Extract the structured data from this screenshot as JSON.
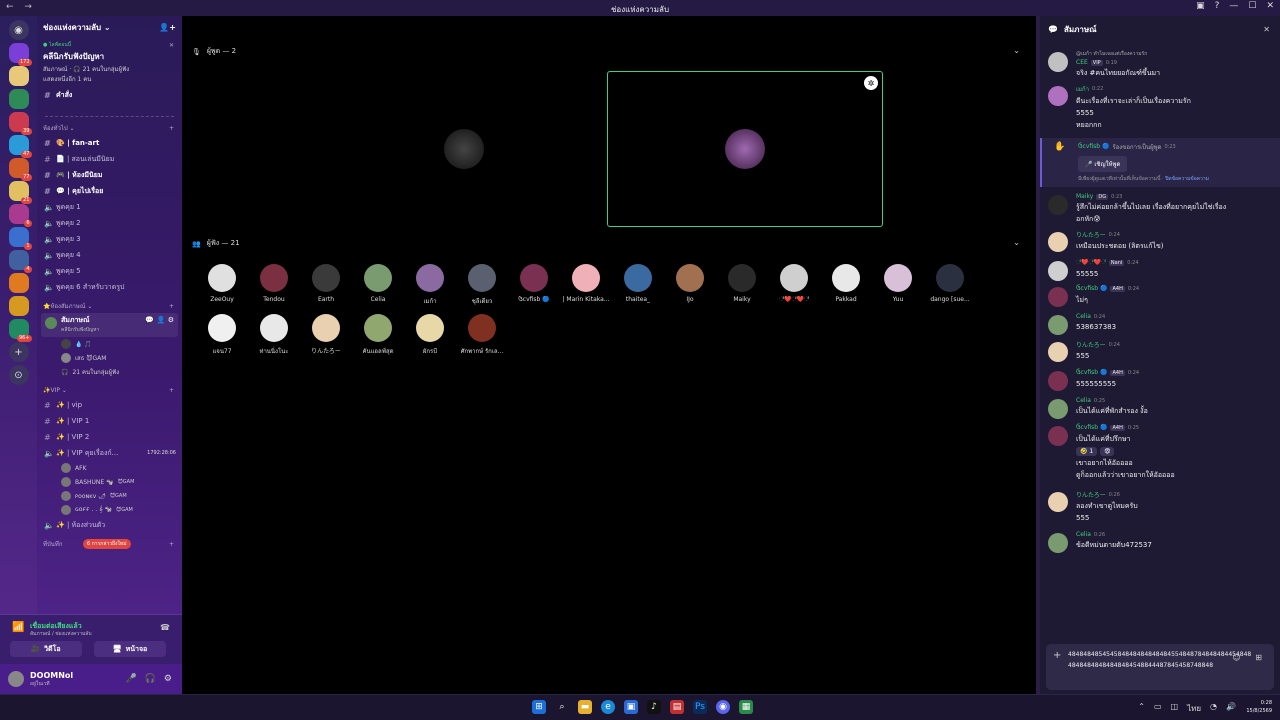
{
  "window": {
    "title": "ช่องแห่งความลับ",
    "nav": "← →"
  },
  "server": {
    "name": "ช่องแห่งความลับ ⌄"
  },
  "servers": [
    {
      "color": "#7a3fd6",
      "count": "172"
    },
    {
      "color": "#e8c97a",
      "count": ""
    },
    {
      "color": "#2e8b57",
      "count": ""
    },
    {
      "color": "#cc3a50",
      "count": "39"
    },
    {
      "color": "#2a9bd8",
      "count": "47"
    },
    {
      "color": "#d05a2a",
      "count": "77"
    },
    {
      "color": "#e0c060",
      "count": "21"
    },
    {
      "color": "#aa3a90",
      "count": "6"
    },
    {
      "color": "#3a6fd0",
      "count": "1"
    },
    {
      "color": "#4060a0",
      "count": "4"
    },
    {
      "color": "#e07a20",
      "count": ""
    },
    {
      "color": "#d69a20",
      "count": ""
    },
    {
      "color": "#208a60",
      "count": "96+"
    }
  ],
  "event": {
    "live": "● ไลฟ์ตอนนี้",
    "title": "คลีนิกรับฟังปัญหา",
    "sub": "สัมภาษณ์ · 🎧 21 คนในกลุ่มผู้ฟัง",
    "more": "แสดงหนึ่งอีก 1 คน"
  },
  "channels_top": [
    {
      "label": "คำสั่ง",
      "bold": true
    }
  ],
  "cat_rooms": "ห้องทั่วไป ⌄",
  "rooms": [
    {
      "label": "🎨 | fan-art",
      "bold": true
    },
    {
      "label": "📄 | สอนเล่นมีนิยม",
      "bold": false
    },
    {
      "label": "🎮 | ห้องมีนิยม",
      "bold": true
    },
    {
      "label": "💬 | คุยไปเรื่อย",
      "bold": true
    },
    {
      "label": "พูดคุย 1",
      "bold": false
    },
    {
      "label": "พูดคุย 2",
      "bold": false
    },
    {
      "label": "พูดคุย 3",
      "bold": false
    },
    {
      "label": "พูดคุย 4",
      "bold": false
    },
    {
      "label": "พูดคุย 5",
      "bold": false
    },
    {
      "label": "พูดคุย 6 สำหรับวาดรูป",
      "bold": false
    }
  ],
  "cat_stage": "⭐ห้องสัมภาษณ์ ⌄",
  "stage": {
    "name": "สัมภาษณ์",
    "topic": "คลีนิกรับฟังปัญหา",
    "members": [
      "💧 🎵",
      "เสธ 😈GAM",
      "21 คนในกลุ่มผู้ฟัง"
    ]
  },
  "cat_vip": "✨VIP ⌄",
  "vip_channels": [
    {
      "label": "✨ | vip",
      "time": ""
    },
    {
      "label": "✨ | VIP 1",
      "time": ""
    },
    {
      "label": "✨ | VIP 2",
      "time": ""
    },
    {
      "label": "✨ | VIP คุยเรื่องก์...",
      "time": "1792:28:06"
    }
  ],
  "vip_members": [
    {
      "name": "AFK",
      "tag": ""
    },
    {
      "name": "BASHUNE 🐄",
      "tag": "😈GAM"
    },
    {
      "name": "ᴘᴏᴏɴᴋᴠ 🌶",
      "tag": "😈GAM"
    },
    {
      "name": "ɢᴏғғ . . 𝄞 🐄",
      "tag": "😈GAM"
    }
  ],
  "last_channel": "✨ | ห้องส่วนตัว",
  "cat_bottom": "ที่บันทึก",
  "new_badge": "6 การกล่าวถึงใหม่",
  "voice": {
    "connected": "เชื่อมต่อเสียงแล้ว",
    "sub": "สัมภาษณ์ / ช่องแห่งความลับ",
    "video": "วิดีโอ",
    "screen": "หน้าจอ"
  },
  "user": {
    "name": "DOOMNol",
    "status": "อยู่ในเวที"
  },
  "main": {
    "speakers_label": "ผู้พูด — 2",
    "audience_label": "ผู้ฟัง — 21",
    "speakers": [
      {
        "bg": "#d4c9a8"
      },
      {
        "bg": "#4a2e32"
      }
    ],
    "audience": [
      {
        "name": "ZeeOuy",
        "c": "#e0e0e0"
      },
      {
        "name": "Tendou",
        "c": "#7a3040"
      },
      {
        "name": "Earth",
        "c": "#3a3a3a"
      },
      {
        "name": "Celia",
        "c": "#7a9a70"
      },
      {
        "name": "เมก้า",
        "c": "#8a6aa0"
      },
      {
        "name": "ชุลีเดียว",
        "c": "#5a6070"
      },
      {
        "name": "ઉcvfisb 🔵",
        "c": "#7a3050"
      },
      {
        "name": "| Marin Kitaka...",
        "c": "#f0b0b8"
      },
      {
        "name": "thaitea_",
        "c": "#3a6aa0"
      },
      {
        "name": "IJo",
        "c": "#a07050"
      },
      {
        "name": "Maiky",
        "c": "#2a2a2a"
      },
      {
        "name": "ೆ❤️ೆ❤️ೆ",
        "c": "#cfcfcf"
      },
      {
        "name": "Pakkad",
        "c": "#e8e8e8"
      },
      {
        "name": "Yuu",
        "c": "#d8c0d8"
      },
      {
        "name": "dango [sue...",
        "c": "#2a3040"
      },
      {
        "name": "แจน77",
        "c": "#f0f0f0"
      },
      {
        "name": "ท่านนิ่งโนะ",
        "c": "#e8e8e8"
      },
      {
        "name": "りんたろー",
        "c": "#e8d0b0"
      },
      {
        "name": "คันแอลฟ์สุด",
        "c": "#90a870"
      },
      {
        "name": "ผักรบี",
        "c": "#e8d8a8"
      },
      {
        "name": "ศักพากษ์ รักเล...",
        "c": "#803020"
      }
    ]
  },
  "chat": {
    "title": "สัมภาษณ์",
    "messages": [
      {
        "reply": "@เมก้า ทำไมเจอแต่เรื่องความรัก",
        "name": "CEE",
        "tag": "VIP",
        "time": "0:19",
        "lines": [
          "จริง #คนไทยยอกัณฑ์ขึ้นมา"
        ],
        "c": "#c0c0c0",
        "hl": false
      },
      {
        "reply": "",
        "name": "เมก้า",
        "tag": "",
        "time": "0:22",
        "lines": [
          "ดีนะเรื่องที่เราจะเล่าก็เป็นเรื่องความรัก",
          "5555",
          "หยอกกก"
        ],
        "c": "#b070c0",
        "hl": false
      },
      {
        "reply": "",
        "name": "ઉcvfisb 🔵",
        "tag": "",
        "time": "0:23",
        "lines": [
          "ร้องขอการเป็นผู้พูด"
        ],
        "c": "",
        "hl": true,
        "invite": "🎤 เชิญให้พูด",
        "note": "มีเพียงผู้ดูแลเวทีเท่านั้นที่เห็นข้อความนี้ · ",
        "note_link": "ปิดข้อความข้อความ"
      },
      {
        "reply": "",
        "name": "Maiky",
        "tag": "DG",
        "time": "0:23",
        "lines": [
          "รู้สึกไม่ค่อยกล้าขึ้นไปเลย เรื่องที่อยากคุยไม่ใช่เรื่อง",
          "อกหัก😰"
        ],
        "c": "#2a2a2a",
        "hl": false
      },
      {
        "reply": "",
        "name": "りんたろー",
        "tag": "",
        "time": "0:24",
        "lines": [
          "เหมือนประชดอย (ลิตรแก้ไข)"
        ],
        "c": "#e8d0b0",
        "hl": false
      },
      {
        "reply": "",
        "name": "ೆ❤️ೆ❤️ೆ",
        "tag": "Nani",
        "time": "0:24",
        "lines": [
          "55555"
        ],
        "c": "#cfcfcf",
        "hl": false
      },
      {
        "reply": "",
        "name": "ઉcvfisb 🔵",
        "tag": "A4H",
        "time": "0:24",
        "lines": [
          "ไม่ๆ"
        ],
        "c": "#7a3050",
        "hl": false
      },
      {
        "reply": "",
        "name": "Celia",
        "tag": "",
        "time": "0:24",
        "lines": [
          "538637383"
        ],
        "c": "#7a9a70",
        "hl": false
      },
      {
        "reply": "",
        "name": "りんたろー",
        "tag": "",
        "time": "0:24",
        "lines": [
          "555"
        ],
        "c": "#e8d0b0",
        "hl": false
      },
      {
        "reply": "",
        "name": "ઉcvfisb 🔵",
        "tag": "A4H",
        "time": "0:24",
        "lines": [
          "555555555"
        ],
        "c": "#7a3050",
        "hl": false
      },
      {
        "reply": "",
        "name": "Celia",
        "tag": "",
        "time": "0:25",
        "lines": [
          "เป็นได้แค่ที่พักสำรอง งั้อ"
        ],
        "c": "#7a9a70",
        "hl": false
      },
      {
        "reply": "",
        "name": "ઉcvfisb 🔵",
        "tag": "A4H",
        "time": "0:25",
        "lines": [
          "เป็นได้แค่ที่ปรึกษา"
        ],
        "c": "#7a3050",
        "hl": false,
        "reacts": [
          "🤣 1",
          "😨"
        ],
        "extra": [
          "เขาอยากไห้อัออออ",
          "ดูก็ออกแล้วว่าเขาอยากให้อัออออ"
        ]
      },
      {
        "reply": "",
        "name": "りんたろー",
        "tag": "",
        "time": "0:26",
        "lines": [
          "ลองทำเขาดูไหมครับ",
          "555"
        ],
        "c": "#e8d0b0",
        "hl": false
      },
      {
        "reply": "",
        "name": "Celia",
        "tag": "",
        "time": "0:26",
        "lines": [
          "ข้อดีหม่นตายตับ472537"
        ],
        "c": "#7a9a70",
        "hl": false
      }
    ],
    "composer": "48484848545458484848484848455484878484848445484848484848484848484548844487845458748848"
  },
  "taskbar": {
    "time": "0:28",
    "date": "15/8/2569",
    "lang": "ไทย"
  }
}
